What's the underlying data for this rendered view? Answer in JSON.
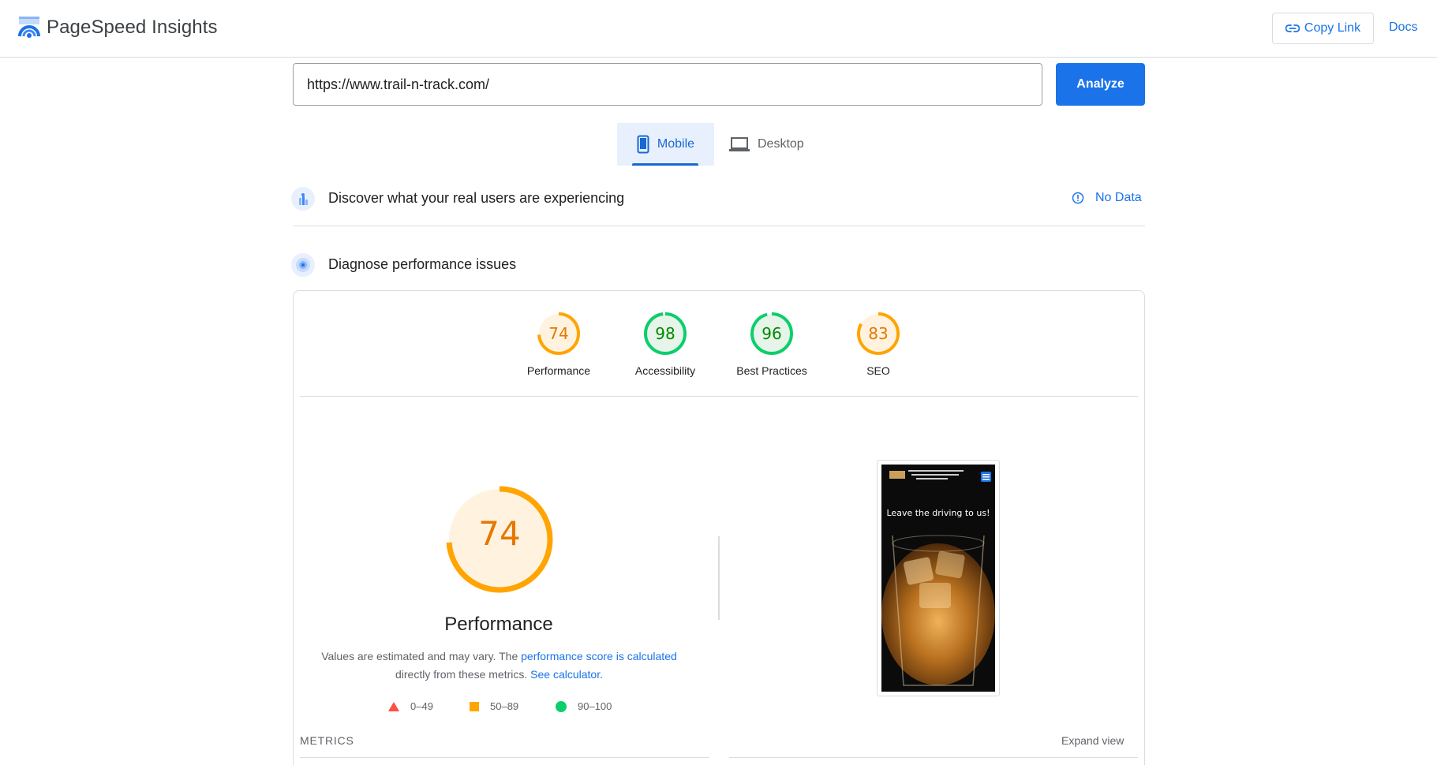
{
  "header": {
    "brand": "PageSpeed Insights",
    "copy_link_label": "Copy Link",
    "docs_label": "Docs"
  },
  "search": {
    "url_value": "https://www.trail-n-track.com/",
    "analyze_label": "Analyze"
  },
  "device_tabs": {
    "mobile_label": "Mobile",
    "desktop_label": "Desktop",
    "selected": "Mobile"
  },
  "field_data": {
    "title": "Discover what your real users are experiencing",
    "status": "No Data"
  },
  "lab_data": {
    "title": "Diagnose performance issues"
  },
  "scores": [
    {
      "label": "Performance",
      "value": "74",
      "color": "#e67700",
      "ring": "#ffa400",
      "fill": "#fff3e0"
    },
    {
      "label": "Accessibility",
      "value": "98",
      "color": "#008800",
      "ring": "#0cce6b",
      "fill": "#e6f4ea"
    },
    {
      "label": "Best Practices",
      "value": "96",
      "color": "#008800",
      "ring": "#0cce6b",
      "fill": "#e6f4ea"
    },
    {
      "label": "SEO",
      "value": "83",
      "color": "#e67700",
      "ring": "#ffa400",
      "fill": "#fff3e0"
    }
  ],
  "performance": {
    "score": "74",
    "score_fraction": 0.74,
    "title": "Performance",
    "desc_prefix": "Values are estimated and may vary. The ",
    "desc_link1": "performance score is calculated",
    "desc_middle": "directly from these metrics. ",
    "desc_link2": "See calculator.",
    "legend": [
      "0–49",
      "50–89",
      "90–100"
    ]
  },
  "screenshot": {
    "headline": "Leave the driving to us!"
  },
  "metrics": {
    "label": "METRICS",
    "expand_label": "Expand view"
  },
  "colors": {
    "accent": "#1a73e8",
    "fail": "#ff4e42",
    "average": "#ffa400",
    "pass": "#0cce6b"
  }
}
